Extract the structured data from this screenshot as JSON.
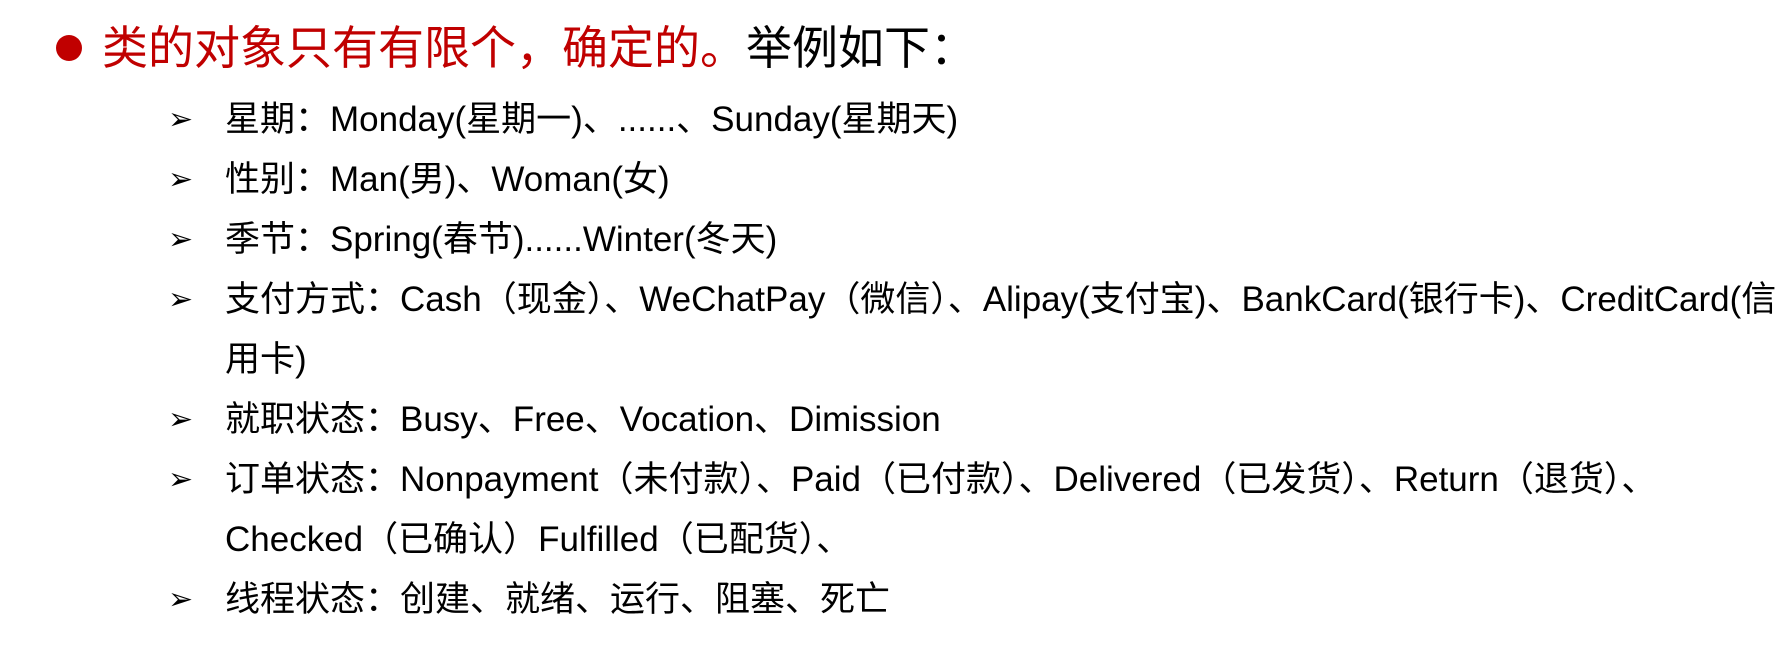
{
  "title": {
    "highlight": "类的对象只有有限个，确定的。",
    "rest": "举例如下：",
    "accent_color": "#c00000",
    "bullet_icon": "filled-circle"
  },
  "items": [
    {
      "icon": "arrow-right",
      "text": "星期：Monday(星期一)、......、Sunday(星期天)"
    },
    {
      "icon": "arrow-right",
      "text": "性别：Man(男)、Woman(女)"
    },
    {
      "icon": "arrow-right",
      "text": "季节：Spring(春节)......Winter(冬天)"
    },
    {
      "icon": "arrow-right",
      "text": "支付方式：Cash（现金）、WeChatPay（微信）、Alipay(支付宝)、BankCard(银行卡)、CreditCard(信用卡)"
    },
    {
      "icon": "arrow-right",
      "text": "就职状态：Busy、Free、Vocation、Dimission"
    },
    {
      "icon": "arrow-right",
      "text": "订单状态：Nonpayment（未付款）、Paid（已付款）、Delivered（已发货）、Return（退货）、Checked（已确认）Fulfilled（已配货）、"
    },
    {
      "icon": "arrow-right",
      "text": "线程状态：创建、就绪、运行、阻塞、死亡"
    }
  ]
}
